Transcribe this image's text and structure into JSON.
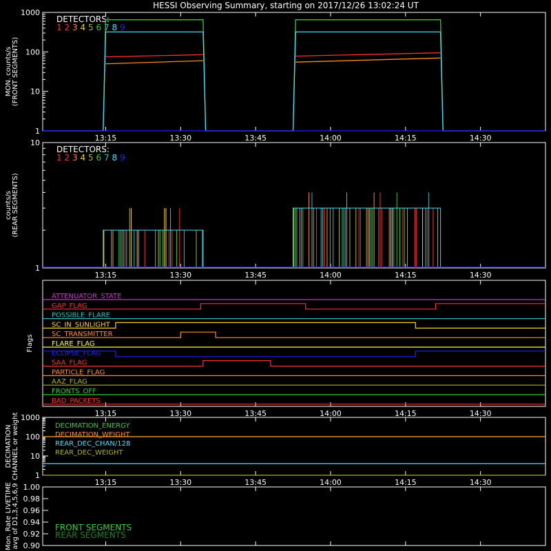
{
  "title": "HESSI Observing Summary, starting on 2017/12/26 13:02:24 UT",
  "time_axis": {
    "ticks": [
      "13:15",
      "13:30",
      "13:45",
      "14:00",
      "14:15",
      "14:30"
    ]
  },
  "detector_labels": [
    {
      "text": "1",
      "color": "#ff3030"
    },
    {
      "text": "2",
      "color": "#ff3030"
    },
    {
      "text": "3",
      "color": "#ff8c20"
    },
    {
      "text": "4",
      "color": "#ffd020"
    },
    {
      "text": "5",
      "color": "#b0b020"
    },
    {
      "text": "6",
      "color": "#30d030"
    },
    {
      "text": "7",
      "color": "#30c0c0"
    },
    {
      "text": "8",
      "color": "#40e0ff"
    },
    {
      "text": "9",
      "color": "#2020ff"
    }
  ],
  "chart_data": [
    {
      "type": "line",
      "panel": "front",
      "ylabel": "MON. counts/s\n(FRONT SEGMENTS)",
      "legend_title": "DETECTORS:",
      "yscale": "log",
      "ylim": [
        1,
        1000
      ],
      "yticks": [
        "1",
        "10",
        "100",
        "1000"
      ],
      "xlim": [
        "13:02:24",
        "14:43:00"
      ],
      "series": [
        {
          "color": "#30d030",
          "segments": [
            {
              "x": [
                "13:14:30",
                "13:15:00",
                "13:34:30",
                "13:35:00"
              ],
              "y": [
                1,
                650,
                650,
                1
              ]
            },
            {
              "x": [
                "13:52:30",
                "13:53:00",
                "14:22:00",
                "14:22:30"
              ],
              "y": [
                1,
                650,
                650,
                1
              ]
            }
          ]
        },
        {
          "color": "#40e0ff",
          "segments": [
            {
              "x": [
                "13:02:24",
                "13:14:30",
                "13:15:00",
                "13:34:30",
                "13:35:00",
                "13:52:30",
                "13:53:00",
                "14:22:00",
                "14:22:30",
                "14:43:00"
              ],
              "y": [
                1,
                1,
                320,
                320,
                1,
                1,
                320,
                320,
                1,
                1
              ]
            }
          ]
        },
        {
          "color": "#ff3030",
          "segments": [
            {
              "x": [
                "13:15:00",
                "13:34:30"
              ],
              "y": [
                75,
                85
              ]
            },
            {
              "x": [
                "13:53:00",
                "14:22:00"
              ],
              "y": [
                78,
                95
              ]
            }
          ]
        },
        {
          "color": "#ff8c20",
          "segments": [
            {
              "x": [
                "13:15:00",
                "13:34:30"
              ],
              "y": [
                50,
                60
              ]
            },
            {
              "x": [
                "13:53:00",
                "14:22:00"
              ],
              "y": [
                55,
                70
              ]
            }
          ]
        },
        {
          "color": "#2020ff",
          "segments": [
            {
              "x": [
                "13:02:24",
                "14:43:00"
              ],
              "y": [
                1,
                1
              ]
            }
          ]
        }
      ]
    },
    {
      "type": "line",
      "panel": "rear",
      "ylabel": "counts/s\n(REAR SEGMENTS)",
      "legend_title": "DETECTORS:",
      "yscale": "log",
      "ylim": [
        1,
        10
      ],
      "yticks": [
        "1",
        "10"
      ],
      "xlim": [
        "13:02:24",
        "14:43:00"
      ],
      "activity": [
        {
          "start": "13:14:30",
          "end": "13:34:30",
          "level": 2
        },
        {
          "start": "13:52:30",
          "end": "14:22:00",
          "level": 3
        }
      ]
    },
    {
      "type": "line",
      "panel": "flags",
      "ylabel": "Flags",
      "flags": [
        {
          "name": "ATTENUATOR_STATE",
          "color": "#d030d0",
          "level": 0,
          "toggles": []
        },
        {
          "name": "GAP_FLAG",
          "color": "#ff3030",
          "level": 0,
          "toggles": [
            "13:34:00",
            "13:55:00",
            "14:21:00"
          ]
        },
        {
          "name": "POSSIBLE_FLARE",
          "color": "#30c0c0",
          "level": 0,
          "toggles": []
        },
        {
          "name": "SC_IN_SUNLIGHT",
          "color": "#ffd020",
          "level": 0,
          "toggles": [
            "13:17:00",
            "14:17:00"
          ]
        },
        {
          "name": "SC_TRANSMITTER",
          "color": "#ff8c20",
          "level": 0,
          "toggles": [
            "13:30:00",
            "13:37:00"
          ]
        },
        {
          "name": "FLARE_FLAG",
          "color": "#ffff40",
          "level": 0,
          "toggles": []
        },
        {
          "name": "ECLIPSE_FLAG",
          "color": "#2020ff",
          "level": 1,
          "toggles": [
            "13:17:00",
            "14:17:00"
          ]
        },
        {
          "name": "SAA_FLAG",
          "color": "#ff3030",
          "level": 0,
          "toggles": [
            "13:34:30",
            "13:48:00"
          ]
        },
        {
          "name": "PARTICLE_FLAG",
          "color": "#ff8c20",
          "level": 0,
          "toggles": []
        },
        {
          "name": "AAZ_FLAG",
          "color": "#b0b020",
          "level": 0,
          "toggles": []
        },
        {
          "name": "FRONTS_OFF",
          "color": "#30d030",
          "level": 0,
          "toggles": []
        },
        {
          "name": "BAD_PACKETS",
          "color": "#ff3030",
          "level": 0,
          "toggles": []
        }
      ]
    },
    {
      "type": "line",
      "panel": "decimation",
      "ylabel": "DECIMATION\nCHANNEL or weight",
      "yscale": "log",
      "ylim": [
        1,
        1000
      ],
      "yticks": [
        "1",
        "10",
        "100",
        "1000"
      ],
      "series": [
        {
          "name": "DECIMATION_ENERGY",
          "color": "#30d030",
          "value": 100
        },
        {
          "name": "DECIMATION_WEIGHT",
          "color": "#ff8c20",
          "value": 100
        },
        {
          "name": "REAR_DEC_CHAN/128",
          "color": "#40e0ff",
          "value": 4
        },
        {
          "name": "REAR_DEC_WEIGHT",
          "color": "#b0b020",
          "value": 1
        }
      ]
    },
    {
      "type": "line",
      "panel": "livetime",
      "ylabel": "Mon. Rate LIVETIME\navg of D1,3,4,5,6,9",
      "ylim": [
        0.9,
        1.0
      ],
      "yticks": [
        "0.90",
        "0.92",
        "0.94",
        "0.96",
        "0.98",
        "1.00"
      ],
      "series": [
        {
          "name": "FRONT SEGMENTS",
          "color": "#30d030"
        },
        {
          "name": "REAR SEGMENTS",
          "color": "#208020"
        }
      ]
    }
  ]
}
